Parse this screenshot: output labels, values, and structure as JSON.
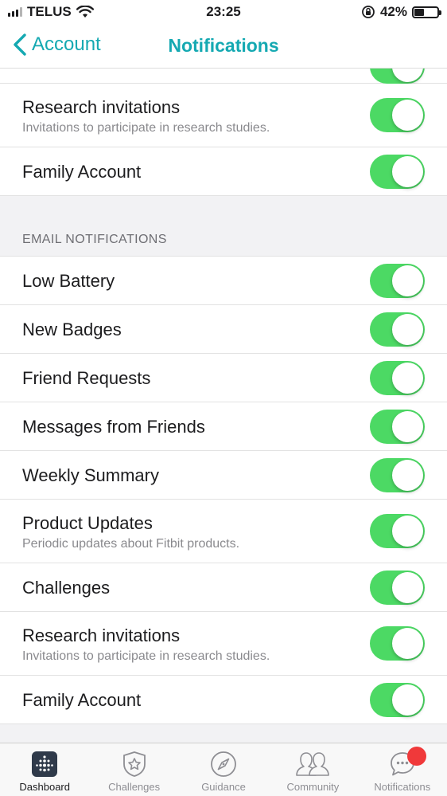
{
  "status_bar": {
    "carrier": "TELUS",
    "time": "23:25",
    "battery_percent": "42%",
    "battery_level": 0.42
  },
  "nav": {
    "back_label": "Account",
    "title": "Notifications"
  },
  "top_section": {
    "rows": [
      {
        "label": "Research invitations",
        "sublabel": "Invitations to participate in research studies.",
        "on": true
      },
      {
        "label": "Family Account",
        "on": true
      }
    ]
  },
  "email_section": {
    "header": "EMAIL NOTIFICATIONS",
    "rows": [
      {
        "label": "Low Battery",
        "on": true
      },
      {
        "label": "New Badges",
        "on": true
      },
      {
        "label": "Friend Requests",
        "on": true
      },
      {
        "label": "Messages from Friends",
        "on": true
      },
      {
        "label": "Weekly Summary",
        "on": true
      },
      {
        "label": "Product Updates",
        "sublabel": "Periodic updates about Fitbit products.",
        "on": true
      },
      {
        "label": "Challenges",
        "on": true
      },
      {
        "label": "Research invitations",
        "sublabel": "Invitations to participate in research studies.",
        "on": true
      },
      {
        "label": "Family Account",
        "on": true
      }
    ]
  },
  "tab_bar": {
    "tabs": [
      {
        "label": "Dashboard",
        "icon": "dashboard-icon",
        "active": true
      },
      {
        "label": "Challenges",
        "icon": "star-badge-icon",
        "active": false
      },
      {
        "label": "Guidance",
        "icon": "compass-icon",
        "active": false
      },
      {
        "label": "Community",
        "icon": "people-icon",
        "active": false
      },
      {
        "label": "Notifications",
        "icon": "chat-bubble-icon",
        "active": false,
        "has_badge": true
      }
    ]
  },
  "colors": {
    "accent": "#15a9b2",
    "toggle_on": "#4cd964",
    "badge": "#f0393a"
  }
}
